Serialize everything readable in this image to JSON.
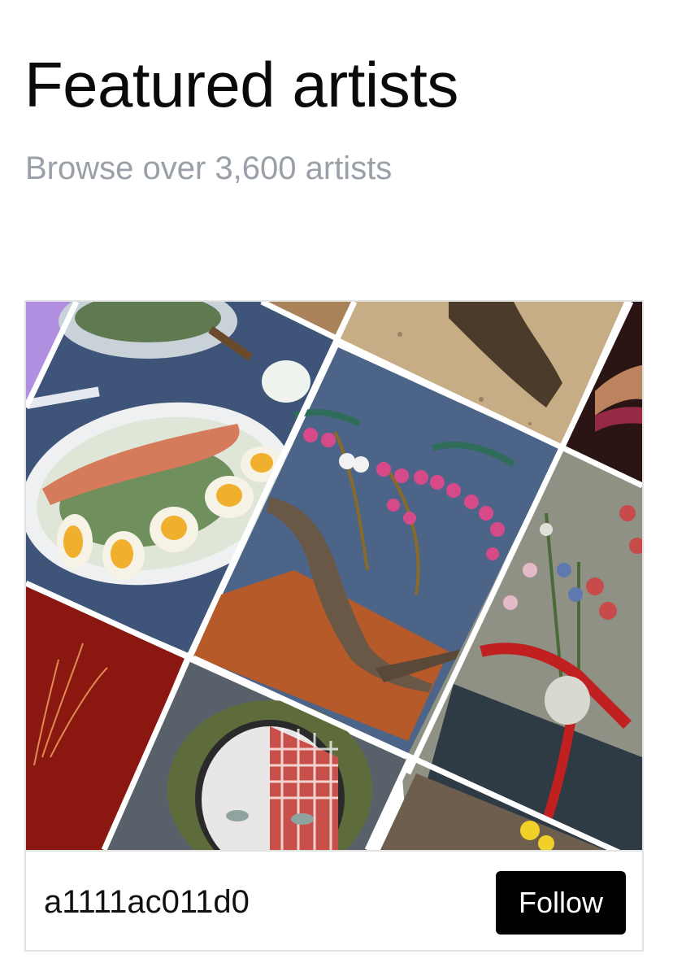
{
  "header": {
    "title": "Featured artists",
    "subtitle": "Browse over 3,600 artists"
  },
  "card": {
    "artist_name": "a1111ac011d0",
    "follow_label": "Follow"
  },
  "collage": {
    "tiles": [
      {
        "name": "salad-egg-salmon-image",
        "color": "#e9ecef"
      },
      {
        "name": "bonsai-bleeding-heart-image",
        "color": "#4a6588"
      },
      {
        "name": "sandy-ground-image",
        "color": "#c8b28a"
      },
      {
        "name": "dark-abstract-image",
        "color": "#3a1d1d"
      },
      {
        "name": "flowers-vase-ribbon-image",
        "color": "#9b9c8c"
      },
      {
        "name": "red-background-grass-image",
        "color": "#8c1a10"
      },
      {
        "name": "masked-portrait-image",
        "color": "#5a6068"
      },
      {
        "name": "yellow-flower-image",
        "color": "#6b5a4a"
      }
    ]
  }
}
